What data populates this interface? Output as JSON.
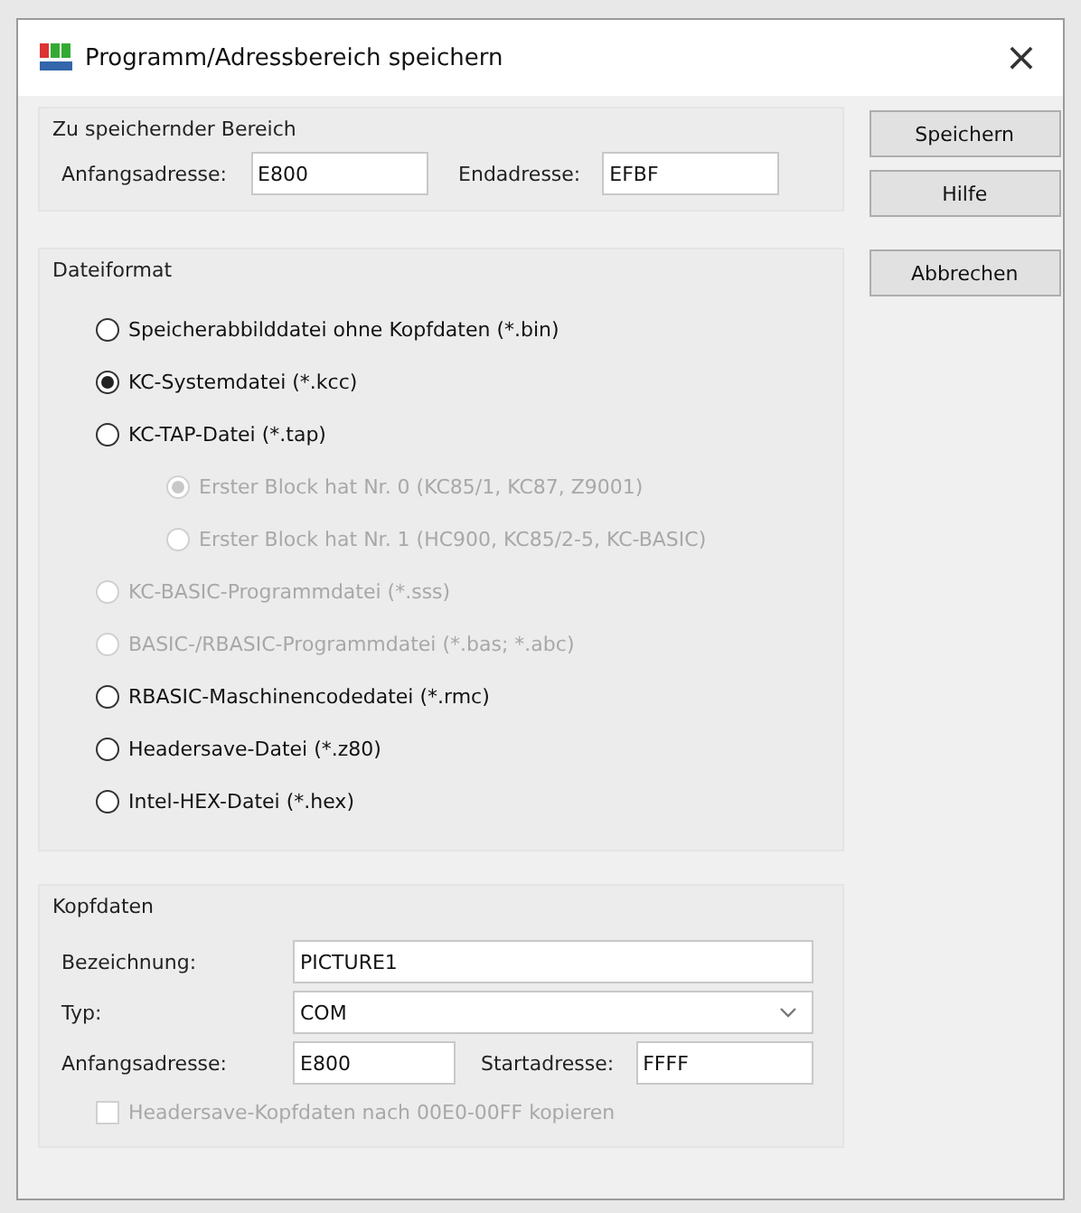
{
  "window": {
    "title": "Programm/Adressbereich speichern",
    "close": "×"
  },
  "range_group": {
    "title": "Zu speichernder Bereich",
    "fields": [
      {
        "label": "Anfangsadresse:",
        "value": "E800"
      },
      {
        "label": "Endadresse:",
        "value": "EFBF"
      }
    ]
  },
  "buttons": [
    {
      "label": "Speichern"
    },
    {
      "label": "Hilfe"
    },
    {
      "label": "Abbrechen"
    }
  ],
  "format_group": {
    "title": "Dateiformat",
    "options": [
      {
        "label": "Speicherabbilddatei ohne Kopfdaten (*.bin)",
        "selected": false,
        "disabled": false
      },
      {
        "label": "KC-Systemdatei (*.kcc)",
        "selected": true,
        "disabled": false
      },
      {
        "label": "KC-TAP-Datei (*.tap)",
        "selected": false,
        "disabled": false,
        "children": [
          {
            "label": "Erster Block hat Nr. 0 (KC85/1, KC87, Z9001)",
            "selected": true,
            "disabled": true
          },
          {
            "label": "Erster Block hat Nr. 1 (HC900, KC85/2-5, KC-BASIC)",
            "selected": false,
            "disabled": true
          }
        ]
      },
      {
        "label": "KC-BASIC-Programmdatei (*.sss)",
        "selected": false,
        "disabled": true
      },
      {
        "label": "BASIC-/RBASIC-Programmdatei (*.bas; *.abc)",
        "selected": false,
        "disabled": true
      },
      {
        "label": "RBASIC-Maschinencodedatei (*.rmc)",
        "selected": false,
        "disabled": false
      },
      {
        "label": "Headersave-Datei (*.z80)",
        "selected": false,
        "disabled": false
      },
      {
        "label": "Intel-HEX-Datei (*.hex)",
        "selected": false,
        "disabled": false
      }
    ]
  },
  "header_group": {
    "title": "Kopfdaten",
    "name_field": {
      "label": "Bezeichnung:",
      "value": "PICTURE1"
    },
    "type_field": {
      "label": "Typ:",
      "value": "COM"
    },
    "address_fields": [
      {
        "label": "Anfangsadresse:",
        "value": "E800"
      },
      {
        "label": "Startadresse:",
        "value": "FFFF"
      }
    ],
    "copy_option": {
      "label": "Headersave-Kopfdaten nach 00E0-00FF kopieren",
      "checked": false,
      "disabled": true
    }
  }
}
